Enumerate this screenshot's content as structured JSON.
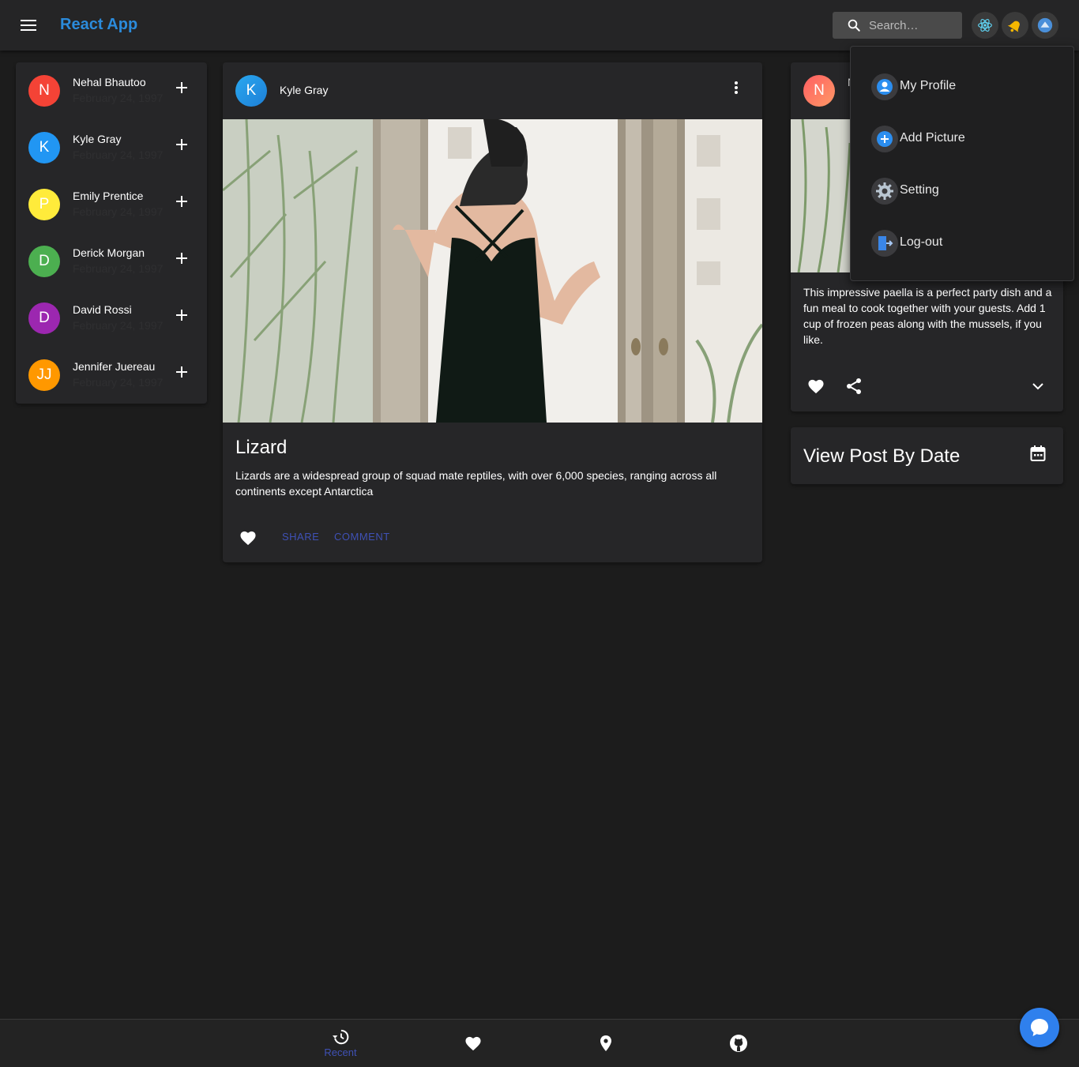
{
  "app": {
    "title": "React App"
  },
  "search": {
    "placeholder": "Search…"
  },
  "header_icons": [
    "react-icon",
    "notification-bell-icon",
    "account-icon"
  ],
  "friends": [
    {
      "initial": "N",
      "name": "Nehal Bhautoo",
      "date": "February 24, 1997",
      "color": "#f44336"
    },
    {
      "initial": "K",
      "name": "Kyle Gray",
      "date": "February 24, 1997",
      "color": "#2196f3"
    },
    {
      "initial": "P",
      "name": "Emily Prentice",
      "date": "February 24, 1997",
      "color": "#ffeb3b"
    },
    {
      "initial": "D",
      "name": "Derick Morgan",
      "date": "February 24, 1997",
      "color": "#4caf50"
    },
    {
      "initial": "D",
      "name": "David Rossi",
      "date": "February 24, 1997",
      "color": "#9c27b0"
    },
    {
      "initial": "JJ",
      "name": "Jennifer Juereau",
      "date": "February 24, 1997",
      "color": "#ff9800"
    }
  ],
  "post": {
    "author_initial": "K",
    "author": "Kyle Gray",
    "title": "Lizard",
    "text": "Lizards are a widespread group of squad mate reptiles, with over 6,000 species, ranging across all continents except Antarctica",
    "share_label": "SHARE",
    "comment_label": "COMMENT"
  },
  "recipe": {
    "author_initial": "N",
    "author_partial": "N",
    "text": "This impressive paella is a perfect party dish and a fun meal to cook together with your guests. Add 1 cup of frozen peas along with the mussels, if you like."
  },
  "date_card": {
    "title": "View Post By Date"
  },
  "menu": {
    "items": [
      {
        "label": "My Profile",
        "icon": "profile-icon"
      },
      {
        "label": "Add Picture",
        "icon": "add-circle-icon"
      },
      {
        "label": "Setting",
        "icon": "settings-gear-icon"
      },
      {
        "label": "Log-out",
        "icon": "logout-door-icon"
      }
    ]
  },
  "bottom_nav": {
    "recent_label": "Recent",
    "items": [
      "history-icon",
      "heart-icon",
      "location-pin-icon",
      "github-icon"
    ]
  },
  "colors": {
    "accent": "#3f51b5",
    "title_blue": "#2b8bdb",
    "fab": "#2f80ed"
  }
}
